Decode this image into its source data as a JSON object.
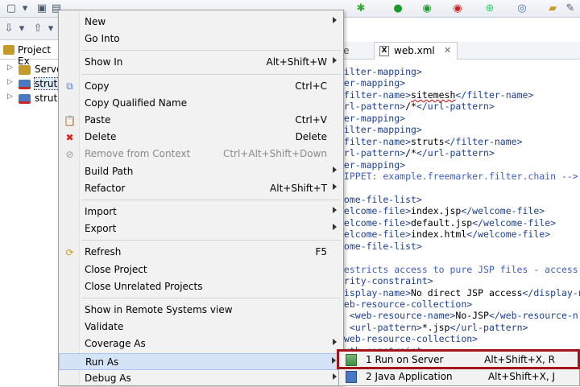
{
  "toolbar_icons": [
    "new-icon",
    "save-icon",
    "print-icon",
    "run-icon",
    "debug-icon",
    "external-tools-icon",
    "search-icon"
  ],
  "project_explorer": {
    "tab_label": "Project Ex",
    "items": [
      {
        "label": "Servers",
        "selected": false
      },
      {
        "label": "struts",
        "selected": true
      },
      {
        "label": "struts",
        "selected": false
      }
    ]
  },
  "editor": {
    "prev_tab_label": "se",
    "tab_label": "web.xml",
    "tab_icon_text": "X",
    "lines": [
      [
        [
          "t",
          "filter-mapping>"
        ]
      ],
      [
        [
          "t",
          "ter-mapping>"
        ]
      ],
      [
        [
          "t",
          "<filter-name>"
        ],
        [
          "vul",
          "sitemesh"
        ],
        [
          "t",
          "</filter-name>"
        ]
      ],
      [
        [
          "t",
          "url-pattern>"
        ],
        [
          "v",
          "/*"
        ],
        [
          "t",
          "</url-pattern>"
        ]
      ],
      [
        [
          "t",
          "ter-mapping>"
        ]
      ],
      [
        [
          "t",
          "filter-mapping>"
        ]
      ],
      [
        [
          "t",
          "<filter-name>"
        ],
        [
          "v",
          "struts"
        ],
        [
          "t",
          "</filter-name>"
        ]
      ],
      [
        [
          "t",
          "url-pattern>"
        ],
        [
          "v",
          "/*"
        ],
        [
          "t",
          "</url-pattern>"
        ]
      ],
      [
        [
          "t",
          "ter-mapping>"
        ]
      ],
      [
        [
          "cmt",
          "NIPPET: example.freemarker.filter.chain -->"
        ]
      ],
      [
        [
          "v",
          ""
        ]
      ],
      [
        [
          "t",
          "come-file-list>"
        ]
      ],
      [
        [
          "t",
          "welcome-file>"
        ],
        [
          "v",
          "index.jsp"
        ],
        [
          "t",
          "</welcome-file>"
        ]
      ],
      [
        [
          "t",
          "welcome-file>"
        ],
        [
          "v",
          "default.jsp"
        ],
        [
          "t",
          "</welcome-file>"
        ]
      ],
      [
        [
          "t",
          "welcome-file>"
        ],
        [
          "v",
          "index.html"
        ],
        [
          "t",
          "</welcome-file>"
        ]
      ],
      [
        [
          "t",
          "come-file-list>"
        ]
      ],
      [
        [
          "v",
          ""
        ]
      ],
      [
        [
          "cmt",
          "Restricts access to pure JSP files - access"
        ]
      ],
      [
        [
          "t",
          "urity-constraint>"
        ]
      ],
      [
        [
          "t",
          "display-name>"
        ],
        [
          "v",
          "No direct JSP access"
        ],
        [
          "t",
          "</display-n"
        ]
      ],
      [
        [
          "t",
          "web-resource-collection>"
        ]
      ],
      [
        [
          "t",
          "  <web-resource-name>"
        ],
        [
          "v",
          "No-JSP"
        ],
        [
          "t",
          "</web-resource-n"
        ]
      ],
      [
        [
          "t",
          "  <url-pattern>"
        ],
        [
          "v",
          "*.jsp"
        ],
        [
          "t",
          "</url-pattern>"
        ]
      ],
      [
        [
          "t",
          "/web-resource-collection>"
        ]
      ],
      [
        [
          "t",
          "auth-constraint>"
        ]
      ]
    ]
  },
  "context_menu": {
    "items": [
      {
        "label": "New",
        "shortcut": "",
        "submenu": true,
        "icon": "",
        "disabled": false
      },
      {
        "label": "Go Into",
        "shortcut": "",
        "submenu": false,
        "icon": "",
        "disabled": false
      },
      {
        "sep": true
      },
      {
        "label": "Show In",
        "shortcut": "Alt+Shift+W",
        "submenu": true,
        "icon": "",
        "disabled": false
      },
      {
        "sep": true
      },
      {
        "label": "Copy",
        "shortcut": "Ctrl+C",
        "submenu": false,
        "icon": "copy-icon",
        "disabled": false
      },
      {
        "label": "Copy Qualified Name",
        "shortcut": "",
        "submenu": false,
        "icon": "",
        "disabled": false
      },
      {
        "label": "Paste",
        "shortcut": "Ctrl+V",
        "submenu": false,
        "icon": "paste-icon",
        "disabled": false
      },
      {
        "label": "Delete",
        "shortcut": "Delete",
        "submenu": false,
        "icon": "delete-icon",
        "disabled": false
      },
      {
        "label": "Remove from Context",
        "shortcut": "Ctrl+Alt+Shift+Down",
        "submenu": false,
        "icon": "remove-context-icon",
        "disabled": true
      },
      {
        "label": "Build Path",
        "shortcut": "",
        "submenu": true,
        "icon": "",
        "disabled": false
      },
      {
        "label": "Refactor",
        "shortcut": "Alt+Shift+T",
        "submenu": true,
        "icon": "",
        "disabled": false
      },
      {
        "sep": true
      },
      {
        "label": "Import",
        "shortcut": "",
        "submenu": true,
        "icon": "",
        "disabled": false
      },
      {
        "label": "Export",
        "shortcut": "",
        "submenu": true,
        "icon": "",
        "disabled": false
      },
      {
        "sep": true
      },
      {
        "label": "Refresh",
        "shortcut": "F5",
        "submenu": false,
        "icon": "refresh-icon",
        "disabled": false
      },
      {
        "label": "Close Project",
        "shortcut": "",
        "submenu": false,
        "icon": "",
        "disabled": false
      },
      {
        "label": "Close Unrelated Projects",
        "shortcut": "",
        "submenu": false,
        "icon": "",
        "disabled": false
      },
      {
        "sep": true
      },
      {
        "label": "Show in Remote Systems view",
        "shortcut": "",
        "submenu": false,
        "icon": "",
        "disabled": false
      },
      {
        "label": "Validate",
        "shortcut": "",
        "submenu": false,
        "icon": "",
        "disabled": false
      },
      {
        "label": "Coverage As",
        "shortcut": "",
        "submenu": true,
        "icon": "",
        "disabled": false
      },
      {
        "label": "Run As",
        "shortcut": "",
        "submenu": true,
        "icon": "",
        "disabled": false,
        "highlighted": true
      },
      {
        "label": "Debug As",
        "shortcut": "",
        "submenu": true,
        "icon": "",
        "disabled": false
      }
    ]
  },
  "run_as_submenu": {
    "items": [
      {
        "label": "1 Run on Server",
        "shortcut": "Alt+Shift+X, R",
        "icon": "run-on-server-icon"
      },
      {
        "label": "2 Java Application",
        "shortcut": "Alt+Shift+X, J",
        "icon": "java-application-icon"
      }
    ]
  },
  "colors": {
    "highlight_box": "#a3151b",
    "menu_hover": "#d5e3f7",
    "xml_tag": "#1c3f94"
  }
}
